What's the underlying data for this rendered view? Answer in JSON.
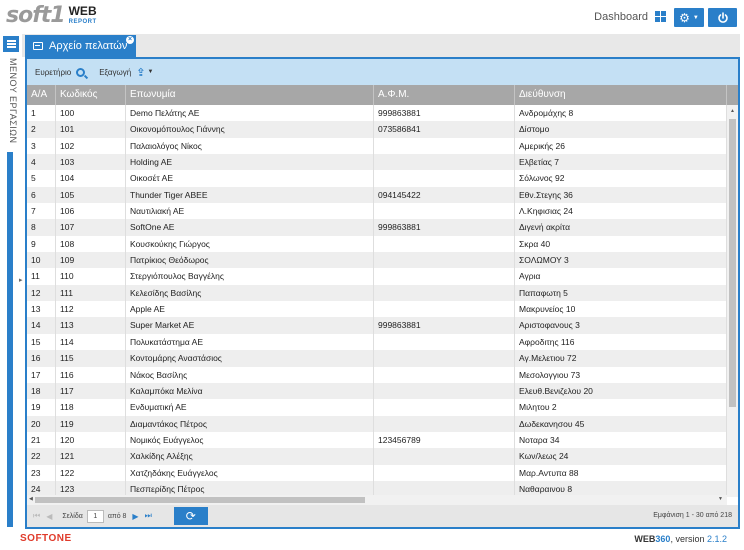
{
  "header": {
    "logo_soft": "soft1",
    "logo_web": "WEB",
    "logo_report": "REPORT",
    "dashboard_label": "Dashboard",
    "accent_color": "#2a7fc9",
    "icons": [
      "grid-icon",
      "gear-icon",
      "power-icon"
    ]
  },
  "side_menu": {
    "label": "ΜΕΝΟΥ ΕΡΓΑΣΙΩΝ",
    "icon": "list-icon"
  },
  "tab": {
    "label": "Αρχείο πελατών",
    "icon": "document-icon"
  },
  "toolbar": {
    "search_label": "Ευρετήριο",
    "export_label": "Εξαγωγή"
  },
  "grid": {
    "columns": [
      "Α/Α",
      "Κωδικός",
      "Επωνυμία",
      "Α.Φ.Μ.",
      "Διεύθυνση"
    ],
    "rows": [
      [
        "1",
        "100",
        "Demo Πελάτης ΑΕ",
        "999863881",
        "Ανδρομάχης 8"
      ],
      [
        "2",
        "101",
        "Οικονομόπουλος Γιάννης",
        "073586841",
        "Δίστομο"
      ],
      [
        "3",
        "102",
        "Παλαιολόγος Νίκος",
        "",
        "Αμερικής 26"
      ],
      [
        "4",
        "103",
        "Holding AE",
        "",
        "Ελβετίας 7"
      ],
      [
        "5",
        "104",
        "Οικοσέτ ΑΕ",
        "",
        "Σόλωνος 92"
      ],
      [
        "6",
        "105",
        "Thunder Tiger ABEE",
        "094145422",
        "Εθν.Στεγης 36"
      ],
      [
        "7",
        "106",
        "Ναυτιλιακή ΑΕ",
        "",
        "Λ.Κηφισιας 24"
      ],
      [
        "8",
        "107",
        "SoftOne AE",
        "999863881",
        "Διγενή ακρίτα"
      ],
      [
        "9",
        "108",
        "Κουσκούκης Γιώργος",
        "",
        "Σκρα 40"
      ],
      [
        "10",
        "109",
        "Πατρίκιος Θεόδωρος",
        "",
        "ΣΟΛΩΜΟΥ 3"
      ],
      [
        "11",
        "110",
        "Στεργιόπουλος Βαγγέλης",
        "",
        "Αγρια"
      ],
      [
        "12",
        "111",
        "Κελεσίδης Βασίλης",
        "",
        "Παπαφωτη 5"
      ],
      [
        "13",
        "112",
        "Apple AE",
        "",
        "Μακρυνείος 10"
      ],
      [
        "14",
        "113",
        "Super Market AE",
        "999863881",
        "Αριστοφανους 3"
      ],
      [
        "15",
        "114",
        "Πολυκατάστημα ΑΕ",
        "",
        "Αφροδιτης 116"
      ],
      [
        "16",
        "115",
        "Κοντομάρης Αναστάσιος",
        "",
        "Αγ.Μελετιου 72"
      ],
      [
        "17",
        "116",
        "Νάκος Βασίλης",
        "",
        "Μεσολογγιου 73"
      ],
      [
        "18",
        "117",
        "Καλαμπόκα Μελίνα",
        "",
        "Ελευθ.Βενιζελου 20"
      ],
      [
        "19",
        "118",
        "Ενδυματική ΑΕ",
        "",
        "Μιλητου 2"
      ],
      [
        "20",
        "119",
        "Διαμαντάκος Πέτρος",
        "",
        "Δωδεκανησου 45"
      ],
      [
        "21",
        "120",
        "Νομικός Ευάγγελος",
        "123456789",
        "Νοταρα 34"
      ],
      [
        "22",
        "121",
        "Χαλκίδης Αλέξης",
        "",
        "Κων/λεως 24"
      ],
      [
        "23",
        "122",
        "Χατζηδάκης Ευάγγελος",
        "",
        "Μαρ.Αντυπα 88"
      ],
      [
        "24",
        "123",
        "Πεσπερίδης Πέτρος",
        "",
        "Ναθαραινου 8"
      ]
    ]
  },
  "pager": {
    "page_label": "Σελίδα",
    "page_value": "1",
    "of_label": "από 8",
    "info": "Εμφάνιση 1 - 30 από 218"
  },
  "footer": {
    "brand": "SOFTONE",
    "product_web": "WEB",
    "product_num": "360",
    "version_label": ", version",
    "version_value": "2.1.2"
  }
}
